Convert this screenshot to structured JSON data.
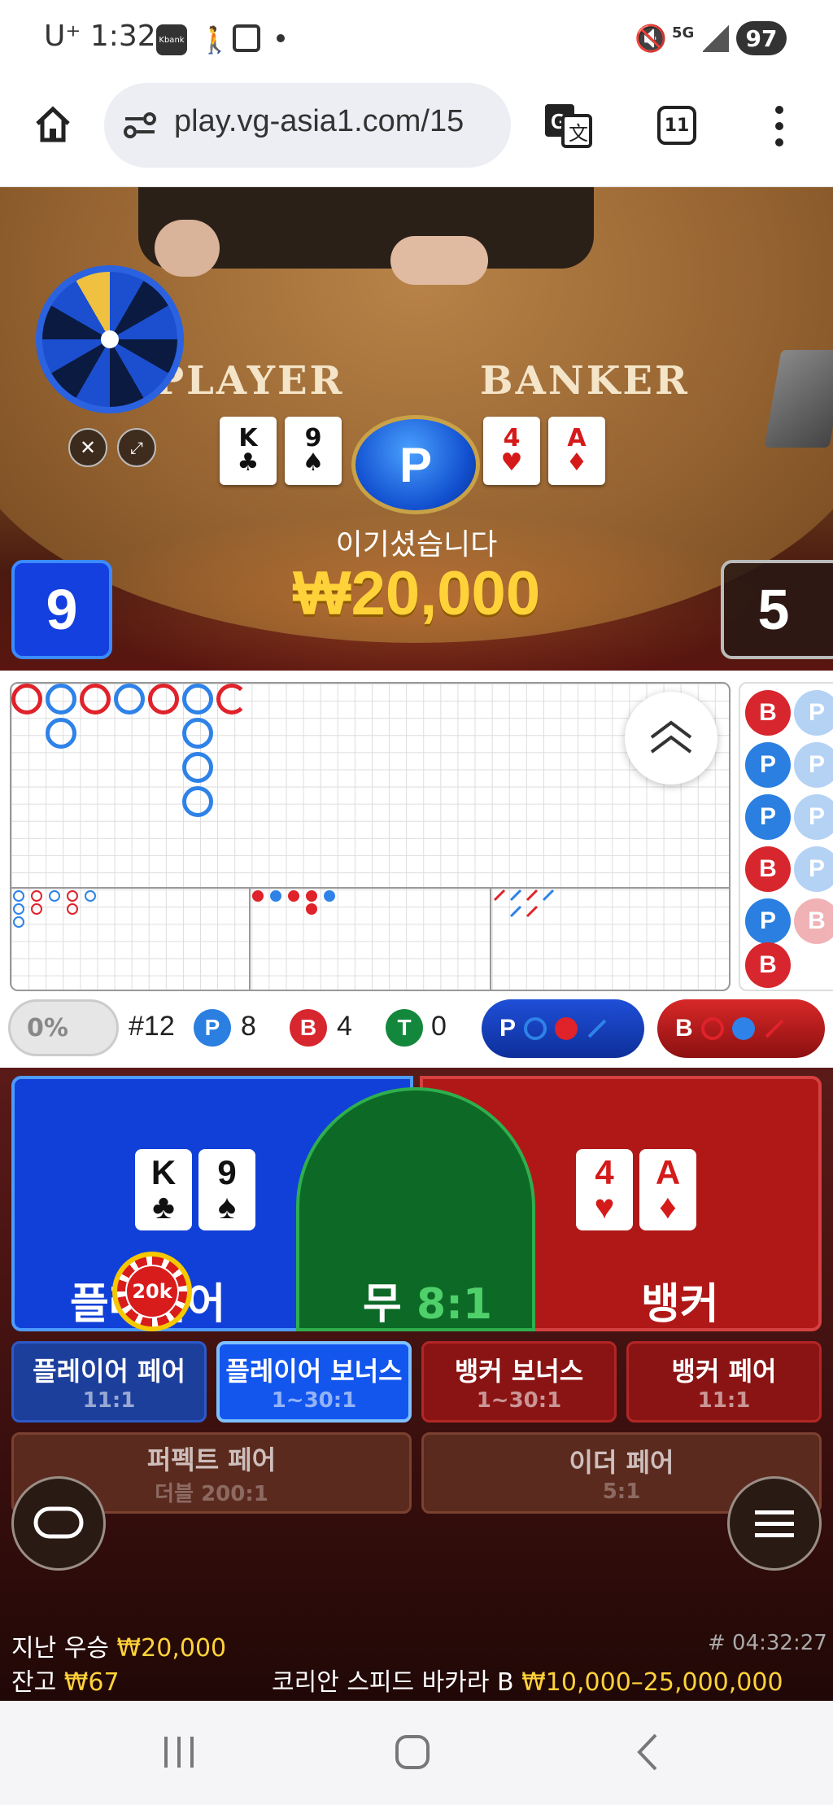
{
  "status_bar": {
    "carrier": "U⁺",
    "time": "1:32",
    "kbank": "Kbank",
    "network": "5G",
    "battery": "97"
  },
  "browser": {
    "url": "play.vg-asia1.com/15",
    "tab_count": "11"
  },
  "video": {
    "player_label": "PLAYER",
    "banker_label": "BANKER",
    "player_cards": [
      {
        "rank": "K",
        "suit": "♣",
        "red": false
      },
      {
        "rank": "9",
        "suit": "♠",
        "red": false
      }
    ],
    "banker_cards": [
      {
        "rank": "4",
        "suit": "♥",
        "red": true
      },
      {
        "rank": "A",
        "suit": "♦",
        "red": true
      }
    ],
    "result_badge": "P",
    "win_message": "이기셨습니다",
    "win_amount": "₩20,000",
    "player_score": "9",
    "banker_score": "5"
  },
  "scoreboard": {
    "stats": {
      "percent": "0%",
      "round": "#12",
      "player_label": "P",
      "player_count": "8",
      "banker_label": "B",
      "banker_count": "4",
      "tie_label": "T",
      "tie_count": "0"
    },
    "predict_player": "P",
    "predict_banker": "B",
    "side_road": [
      "B",
      "P",
      "P",
      "B",
      "P",
      "B"
    ]
  },
  "bets": {
    "player": "플레이어",
    "tie": "무",
    "tie_odds": "8:1",
    "banker": "뱅커",
    "player_cards": [
      {
        "rank": "K",
        "suit": "♣"
      },
      {
        "rank": "9",
        "suit": "♠"
      }
    ],
    "banker_cards": [
      {
        "rank": "4",
        "suit": "♥"
      },
      {
        "rank": "A",
        "suit": "♦"
      }
    ],
    "chip": "20k",
    "side_bets": [
      {
        "name": "플레이어 페어",
        "odds": "11:1"
      },
      {
        "name": "플레이어 보너스",
        "odds": "1~30:1"
      },
      {
        "name": "뱅커 보너스",
        "odds": "1~30:1"
      },
      {
        "name": "뱅커 페어",
        "odds": "11:1"
      }
    ],
    "perfect_pair": {
      "name": "퍼펙트 페어",
      "odds": "더블 200:1"
    },
    "either_pair": {
      "name": "이더 페어",
      "odds": "5:1"
    }
  },
  "footer": {
    "last_win_label": "지난 우승",
    "last_win_amount": "₩20,000",
    "balance_label": "잔고",
    "balance_amount": "₩67",
    "game_id": "# 04:32:27",
    "table_name": "코리안 스피드 바카라 B",
    "limits": "₩10,000–25,000,000"
  },
  "colors": {
    "player_blue": "#1140d8",
    "banker_red": "#b01818",
    "tie_green": "#0c6a26",
    "gold": "#ffd23a"
  }
}
